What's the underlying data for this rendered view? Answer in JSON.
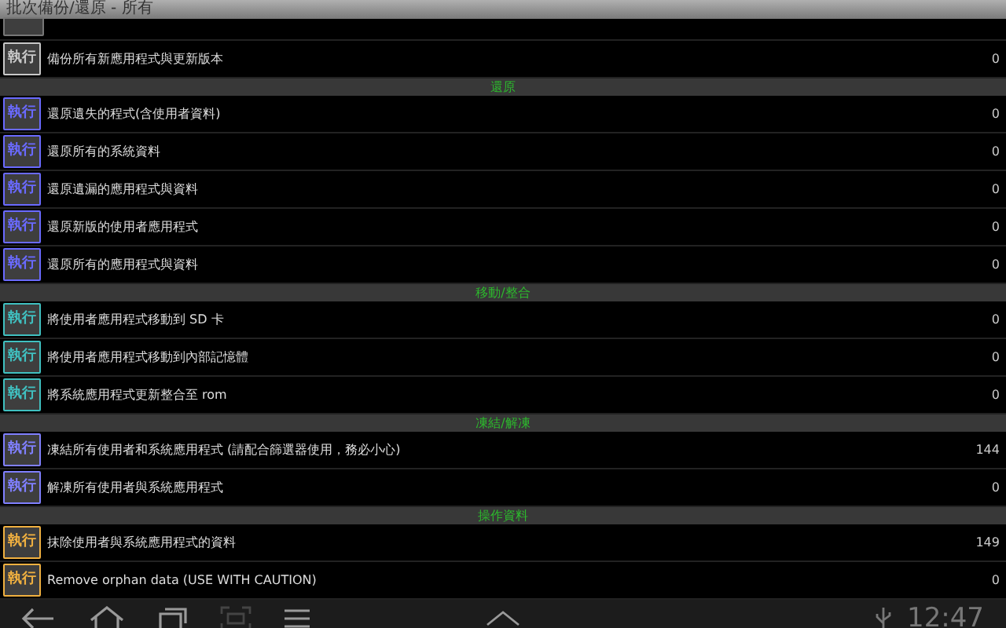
{
  "window": {
    "title": "批次備份/還原 - 所有"
  },
  "list": [
    {
      "kind": "clipped_task"
    },
    {
      "kind": "task",
      "button": "執行",
      "color": "#c8c8c8",
      "label": "備份所有新應用程式與更新版本",
      "count": "0"
    },
    {
      "kind": "section",
      "label": "還原"
    },
    {
      "kind": "task",
      "button": "執行",
      "color": "#6a6aff",
      "label": "還原遺失的程式(含使用者資料)",
      "count": "0"
    },
    {
      "kind": "task",
      "button": "執行",
      "color": "#6a6aff",
      "label": "還原所有的系統資料",
      "count": "0"
    },
    {
      "kind": "task",
      "button": "執行",
      "color": "#6a6aff",
      "label": "還原遺漏的應用程式與資料",
      "count": "0"
    },
    {
      "kind": "task",
      "button": "執行",
      "color": "#6a6aff",
      "label": "還原新版的使用者應用程式",
      "count": "0"
    },
    {
      "kind": "task",
      "button": "執行",
      "color": "#6a6aff",
      "label": "還原所有的應用程式與資料",
      "count": "0"
    },
    {
      "kind": "section",
      "label": "移動/整合"
    },
    {
      "kind": "task",
      "button": "執行",
      "color": "#40c0c0",
      "label": "將使用者應用程式移動到 SD 卡",
      "count": "0"
    },
    {
      "kind": "task",
      "button": "執行",
      "color": "#40c0c0",
      "label": "將使用者應用程式移動到內部記憶體",
      "count": "0"
    },
    {
      "kind": "task",
      "button": "執行",
      "color": "#40c0c0",
      "label": "將系統應用程式更新整合至 rom",
      "count": "0"
    },
    {
      "kind": "section",
      "label": "凍結/解凍"
    },
    {
      "kind": "task",
      "button": "執行",
      "color": "#8080ff",
      "label": "凍結所有使用者和系統應用程式 (請配合篩選器使用，務必小心)",
      "count": "144"
    },
    {
      "kind": "task",
      "button": "執行",
      "color": "#8080ff",
      "label": "解凍所有使用者與系統應用程式",
      "count": "0"
    },
    {
      "kind": "section",
      "label": "操作資料"
    },
    {
      "kind": "task",
      "button": "執行",
      "color": "#f0b040",
      "label": "抹除使用者與系統應用程式的資料",
      "count": "149"
    },
    {
      "kind": "task",
      "button": "執行",
      "color": "#f0b040",
      "label": "Remove orphan data (USE WITH CAUTION)",
      "count": "0"
    }
  ],
  "status_bar": {
    "time": "12:47"
  }
}
